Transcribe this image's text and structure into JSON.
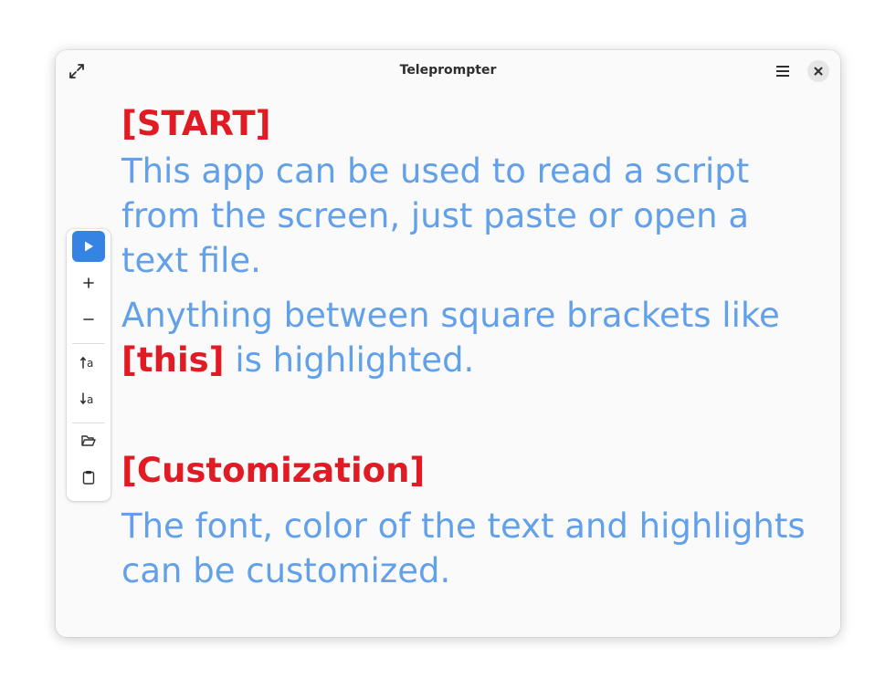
{
  "window": {
    "title": "Teleprompter"
  },
  "toolbar": {
    "buttons": [
      {
        "icon": "play-icon",
        "tooltip": ""
      },
      {
        "icon": "plus-icon"
      },
      {
        "icon": "minus-icon"
      },
      {
        "icon": "font-size-up-icon"
      },
      {
        "icon": "font-size-down-icon"
      },
      {
        "icon": "open-folder-icon"
      },
      {
        "icon": "clipboard-icon"
      }
    ]
  },
  "script": {
    "heading_start": "[START]",
    "para1": "This app can be used to read a script from the screen, just paste or open a text file.",
    "para2_before": "Anything between square brackets like ",
    "para2_highlight": "[this]",
    "para2_after": " is highlighted.",
    "heading_custom": "[Customization]",
    "para3": "The font, color of the text and highlights can be customized."
  },
  "colors": {
    "text": "#62a0ea",
    "highlight": "#e01b24",
    "accent": "#3584e4",
    "window_bg": "#fafafa"
  }
}
